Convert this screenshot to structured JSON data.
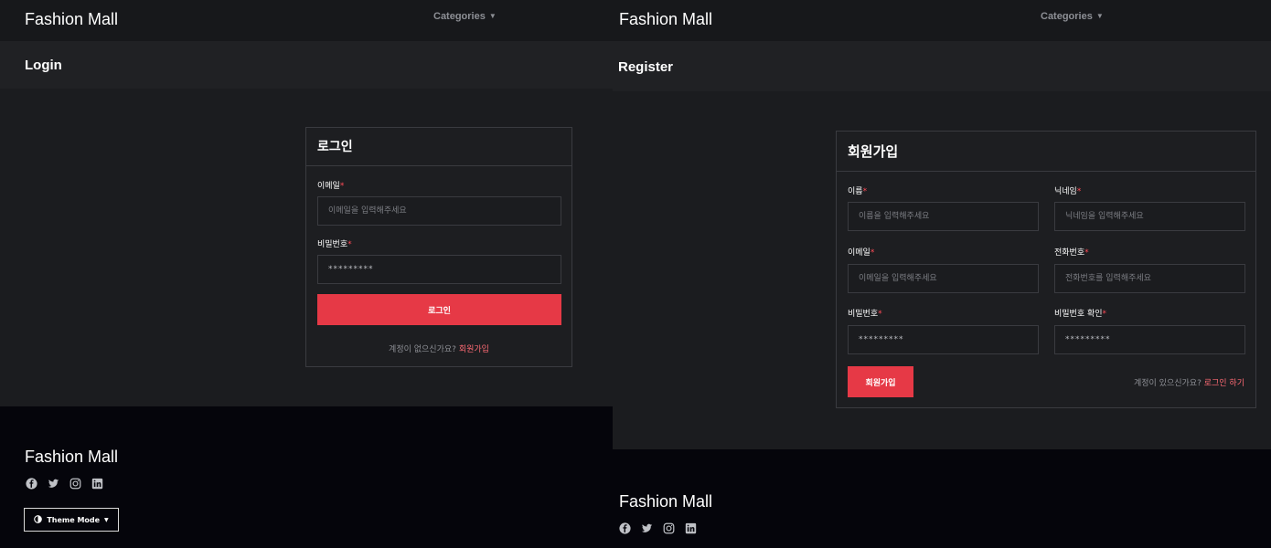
{
  "colors": {
    "accent": "#e63946",
    "link": "#ff6b74",
    "required": "#ff4b57",
    "footer_bg": "#05050b"
  },
  "login_page": {
    "header": {
      "brand": "Fashion Mall",
      "categories_label": "Categories",
      "categories_icon": "chevron-down-icon"
    },
    "page_title": "Login",
    "card_title": "로그인",
    "email": {
      "label": "이메일",
      "required_mark": "*",
      "placeholder": "이메일을 입력해주세요"
    },
    "password": {
      "label": "비밀번호",
      "required_mark": "*",
      "value": "*********"
    },
    "submit_label": "로그인",
    "signup_prompt": "계정이 없으신가요?",
    "signup_link": "회원가입",
    "footer": {
      "brand": "Fashion Mall",
      "social_icons": [
        "facebook-icon",
        "twitter-icon",
        "instagram-icon",
        "linkedin-icon"
      ],
      "theme_mode_label": "Theme Mode"
    }
  },
  "register_page": {
    "header": {
      "brand": "Fashion Mall",
      "categories_label": "Categories",
      "categories_icon": "chevron-down-icon"
    },
    "page_title": "Register",
    "card_title": "회원가입",
    "name": {
      "label": "이름",
      "required_mark": "*",
      "placeholder": "이름을 입력해주세요"
    },
    "nickname": {
      "label": "닉네임",
      "required_mark": "*",
      "placeholder": "닉네임을 입력해주세요"
    },
    "email": {
      "label": "이메일",
      "required_mark": "*",
      "placeholder": "이메일을 입력해주세요"
    },
    "phone": {
      "label": "전화번호",
      "required_mark": "*",
      "placeholder": "전화번호를 입력해주세요"
    },
    "password": {
      "label": "비밀번호",
      "required_mark": "*",
      "value": "*********"
    },
    "password_confirm": {
      "label": "비밀번호 확인",
      "required_mark": "*",
      "value": "*********"
    },
    "submit_label": "회원가입",
    "login_prompt": "계정이 있으신가요?",
    "login_link": "로그인 하기",
    "footer": {
      "brand": "Fashion Mall",
      "social_icons": [
        "facebook-icon",
        "twitter-icon",
        "instagram-icon",
        "linkedin-icon"
      ]
    }
  }
}
